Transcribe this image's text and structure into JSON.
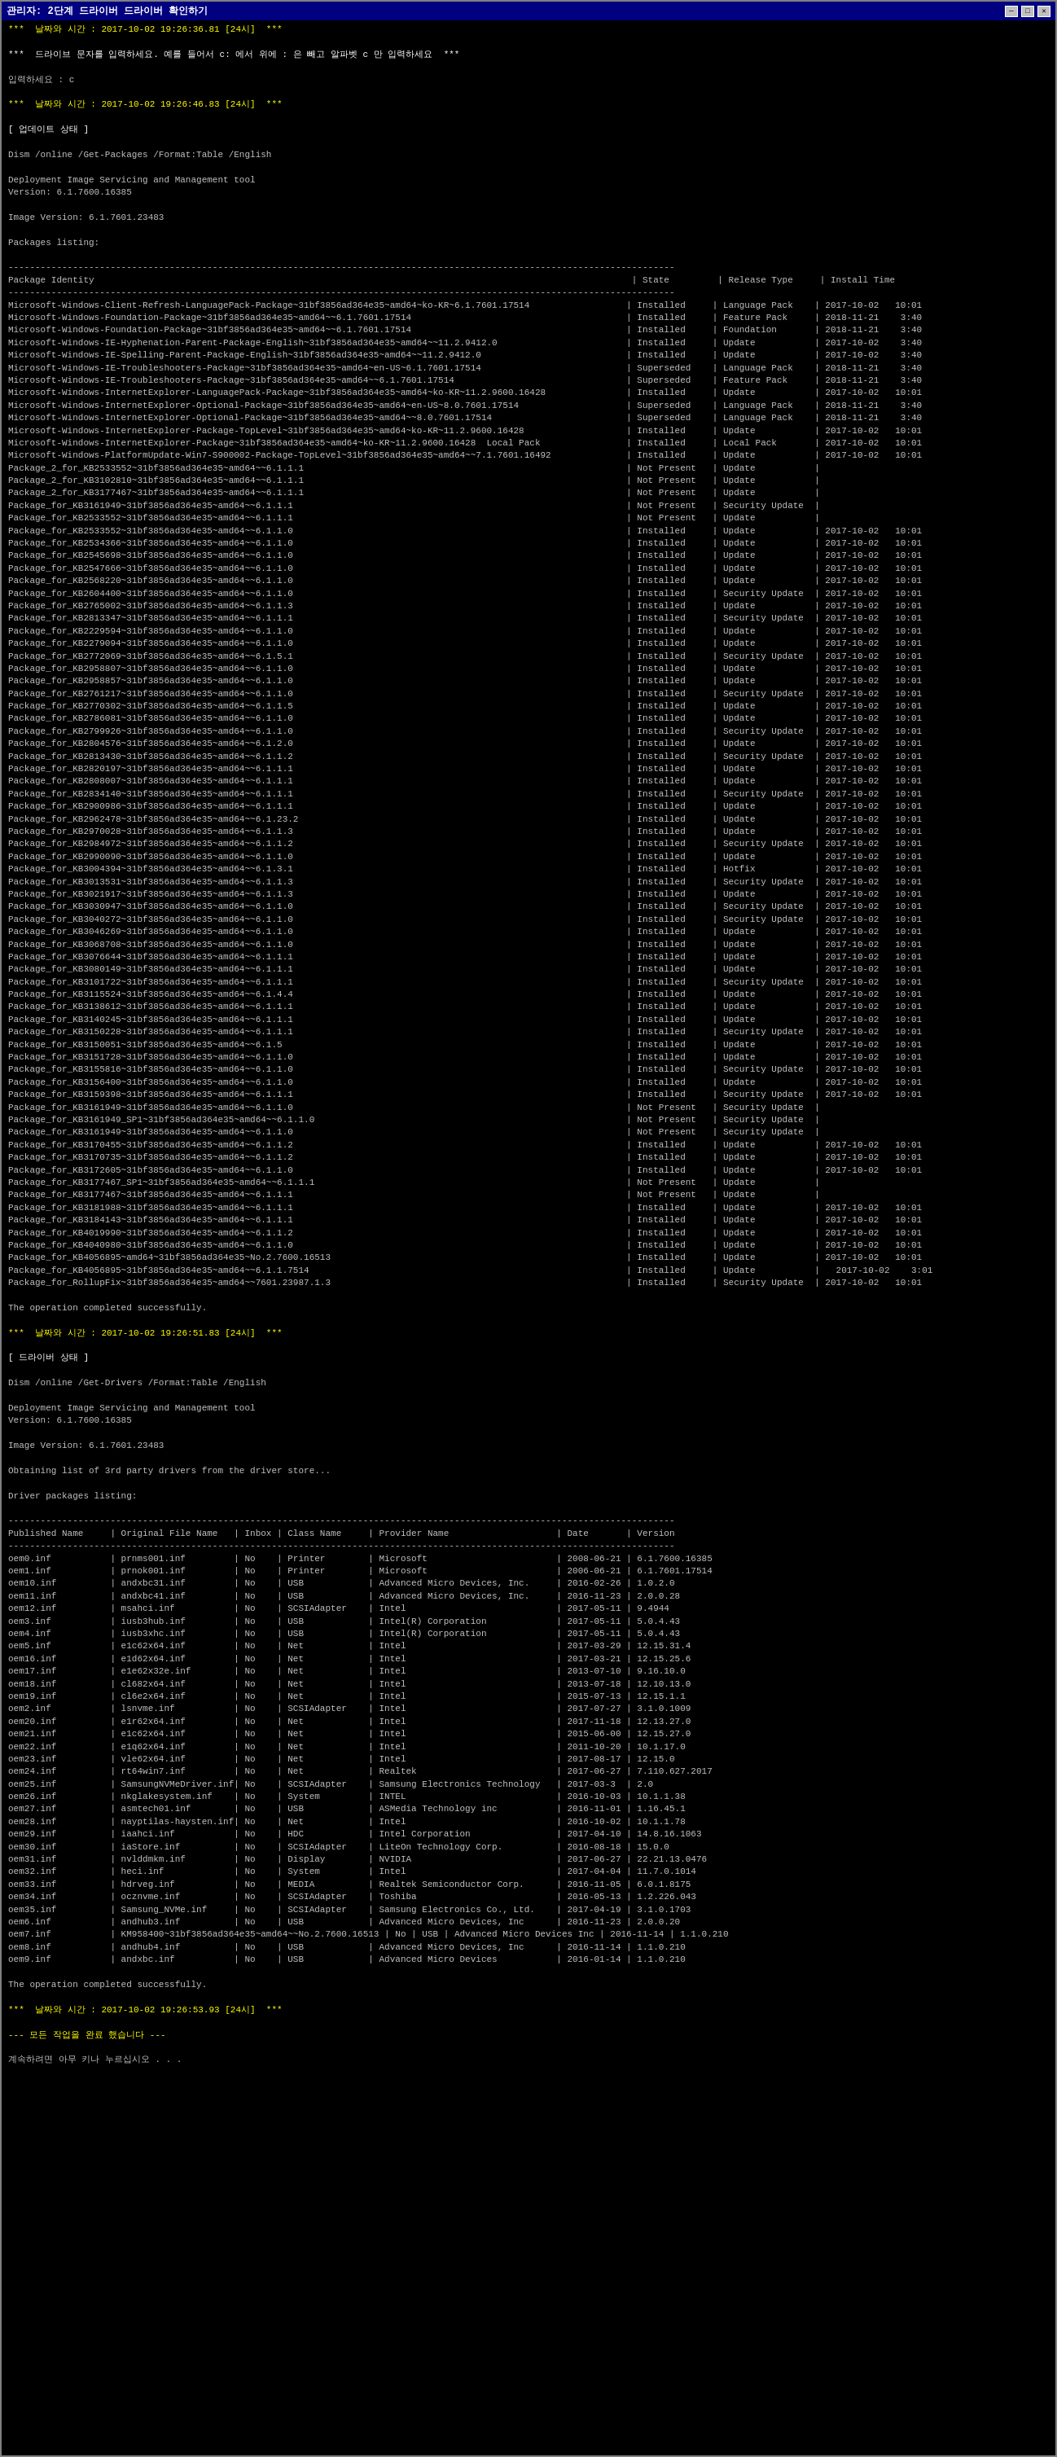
{
  "window": {
    "title": "관리자: 2단계 드라이버 드라이버 확인하기",
    "minimize": "─",
    "maximize": "□",
    "close": "✕"
  },
  "terminal": {
    "sections": [
      {
        "type": "timestamp",
        "text": "***  날짜와 시간 : 2017-10-02 19:26:36.81 [24시]  ***"
      },
      {
        "type": "prompt",
        "text": "***  드라이브 문자를 입력하세요. 예를 들어서 c: 에서 위에 : 은 빼고 알파벳 c 만 입력하세요  ***"
      },
      {
        "type": "input",
        "text": "입력하세요 : c"
      },
      {
        "type": "timestamp",
        "text": "***  날짜와 시간 : 2017-10-02 19:26:46.83 [24시]  ***"
      },
      {
        "type": "section",
        "text": "[ 업데이트 상태 ]"
      },
      {
        "type": "command",
        "text": "Dism /online /Get-Packages /Format:Table /English"
      },
      {
        "type": "info",
        "text": "Deployment Image Servicing and Management tool\nVersion: 6.1.7600.16385\n\nImage Version: 6.1.7601.23483\n\nPackages listing:"
      }
    ]
  }
}
